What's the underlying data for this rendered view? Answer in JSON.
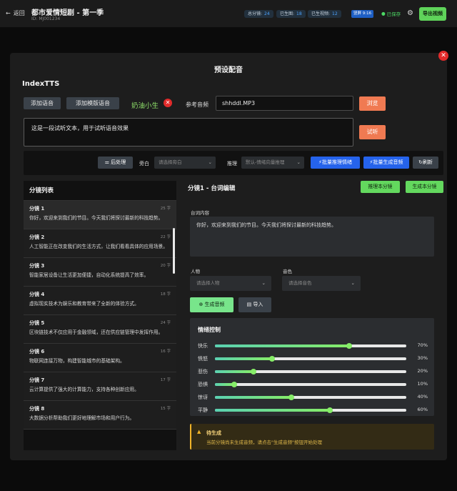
{
  "header": {
    "back_label": "返回",
    "title": "都市爱情短剧 - 第一季",
    "project_id": "ID: MJ001234",
    "stats": [
      {
        "label": "总分镜:",
        "value": "24"
      },
      {
        "label": "已生图:",
        "value": "18"
      },
      {
        "label": "已生视频:",
        "value": "12"
      }
    ],
    "ratio": "竖屏 9:16",
    "saved": "已保存",
    "export_label": "导出视频"
  },
  "modal": {
    "title": "预设配音",
    "engine": "IndexTTS",
    "add_voice": "添加语音",
    "add_template_voice": "添加模版语音",
    "voice_name": "奶油小生",
    "ref_audio_label": "参考音频",
    "ref_audio_value": "shhddl.MP3",
    "browse": "浏览",
    "sample_text": "这是一段试听文本，用于试听语音效果",
    "listen": "试听"
  },
  "toolbar": {
    "post_process": "后处理",
    "narration_label": "旁白",
    "narration_placeholder": "请选择旁白",
    "infer_label": "推理",
    "infer_placeholder": "默认-情绪向量推理",
    "batch_infer": "批量推理情绪",
    "batch_generate": "批量生成音频",
    "refresh": "刷新"
  },
  "segment_list": {
    "title": "分镜列表",
    "items": [
      {
        "title": "分镜 1",
        "count": "25 字",
        "text": "你好，欢迎来到我们的节目。今天我们将探讨最新的科技趋势。"
      },
      {
        "title": "分镜 2",
        "count": "22 字",
        "text": "人工智能正在改变我们的生活方式，让我们看看具体的应用场景。"
      },
      {
        "title": "分镜 3",
        "count": "20 字",
        "text": "智能家居设备让生活更加便捷，自动化系统提高了效率。"
      },
      {
        "title": "分镜 4",
        "count": "18 字",
        "text": "虚拟现实技术为娱乐和教育带来了全新的体验方式。"
      },
      {
        "title": "分镜 5",
        "count": "24 字",
        "text": "区块链技术不仅应用于金融领域，还在供应链管理中发挥作用。"
      },
      {
        "title": "分镜 6",
        "count": "16 字",
        "text": "物联网连接万物，构建智能城市的基础架构。"
      },
      {
        "title": "分镜 7",
        "count": "17 字",
        "text": "云计算提供了强大的计算能力，支持各种创新应用。"
      },
      {
        "title": "分镜 8",
        "count": "15 字",
        "text": "大数据分析帮助我们更好地理解市场和用户行为。"
      }
    ]
  },
  "editor": {
    "title": "分镜1 - 台词编辑",
    "infer_this": "推理本分镜",
    "generate_this": "生成本分镜",
    "content_label": "台词内容",
    "content": "你好，欢迎来到我们的节目。今天我们将探讨最新的科技趋势。",
    "character_label": "人物",
    "character_placeholder": "请选择人物",
    "timbre_label": "音色",
    "timbre_placeholder": "请选择音色",
    "generate_audio": "生成音频",
    "import": "导入"
  },
  "emotion": {
    "title": "情绪控制",
    "items": [
      {
        "label": "快乐",
        "value": 70,
        "display": "70%"
      },
      {
        "label": "愤怒",
        "value": 30,
        "display": "30%"
      },
      {
        "label": "悲伤",
        "value": 20,
        "display": "20%"
      },
      {
        "label": "恐惧",
        "value": 10,
        "display": "10%"
      },
      {
        "label": "惊讶",
        "value": 40,
        "display": "40%"
      },
      {
        "label": "平静",
        "value": 60,
        "display": "60%"
      }
    ]
  },
  "status": {
    "title": "待生成",
    "text": "当前分镜尚未生成音频，请点击\"生成音频\"按钮开始处理"
  }
}
